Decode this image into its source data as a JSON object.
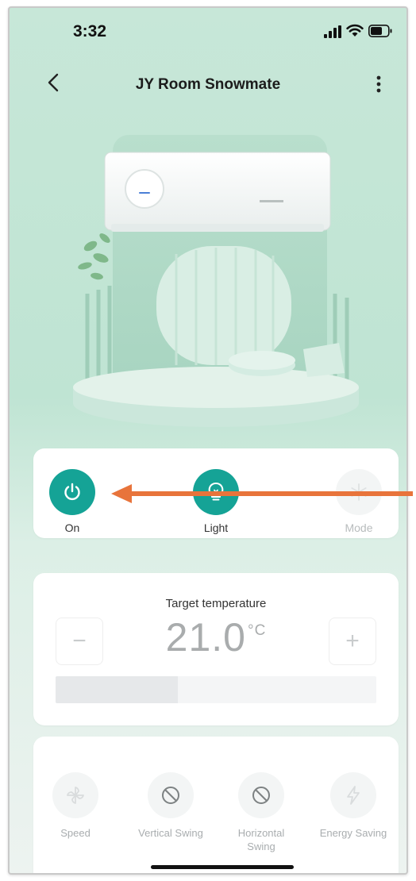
{
  "status_bar": {
    "time": "3:32"
  },
  "header": {
    "title": "JY Room Snowmate"
  },
  "controls": [
    {
      "label": "On",
      "icon": "power-icon",
      "active": true
    },
    {
      "label": "Light",
      "icon": "lightbulb-icon",
      "active": true
    },
    {
      "label": "Mode",
      "icon": "snowflake-icon",
      "active": false
    }
  ],
  "temperature": {
    "label": "Target temperature",
    "value": "21.0",
    "unit": "°C",
    "minus": "−",
    "plus": "+",
    "slider_fraction": 0.38
  },
  "functions": [
    {
      "label": "Speed",
      "icon": "fan-icon"
    },
    {
      "label": "Vertical Swing",
      "icon": "prohibited-icon"
    },
    {
      "label": "Horizontal Swing",
      "icon": "prohibited-icon"
    },
    {
      "label": "Energy Saving",
      "icon": "lightning-icon"
    }
  ],
  "colors": {
    "accent": "#15a396",
    "annotation_arrow": "#e8743b",
    "background_top": "#c7e7d8"
  }
}
